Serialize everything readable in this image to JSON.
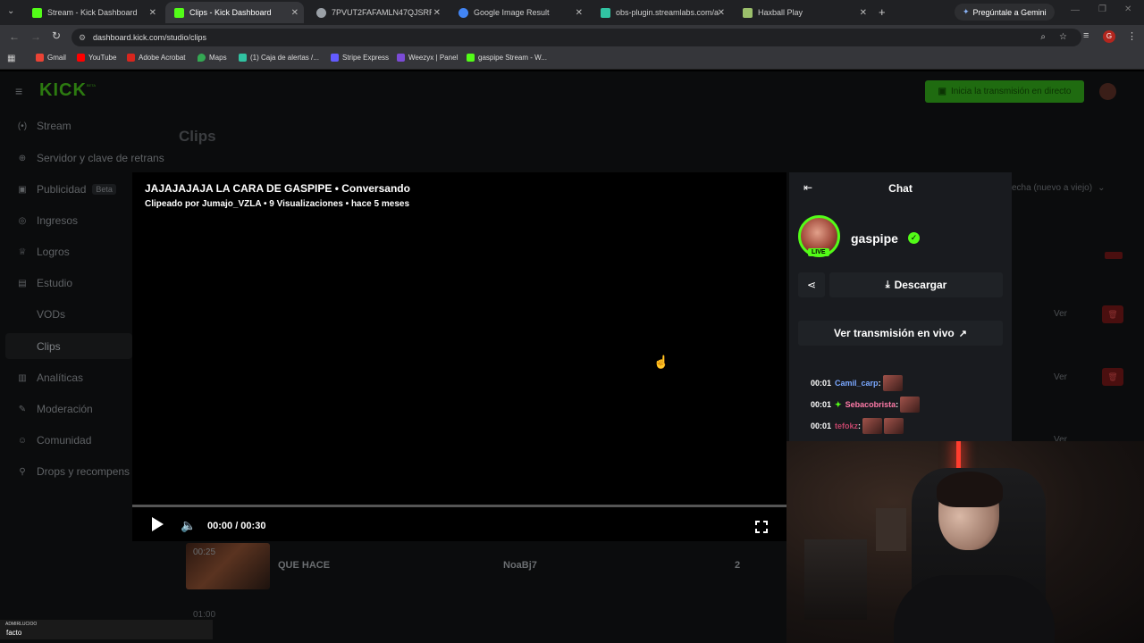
{
  "browser": {
    "tabs": [
      {
        "label": "Stream - Kick Dashboard",
        "favicon_color": "#53fc18"
      },
      {
        "label": "Clips - Kick Dashboard",
        "favicon_color": "#53fc18"
      },
      {
        "label": "7PVUT2FAFAMLN47QJSRR3AU",
        "favicon_color": "#9aa0a6"
      },
      {
        "label": "Google Image Result",
        "favicon_color": "#4285f4"
      },
      {
        "label": "obs-plugin.streamlabs.com/au",
        "favicon_color": "#31c3a2"
      },
      {
        "label": "Haxball Play",
        "favicon_color": "#9bbf6b"
      }
    ],
    "gemini_label": "Pregúntale a Gemini",
    "url": "dashboard.kick.com/studio/clips",
    "profile_initial": "G",
    "bookmarks": [
      {
        "label": "Gmail",
        "color": "#ea4335"
      },
      {
        "label": "YouTube",
        "color": "#ff0000"
      },
      {
        "label": "Adobe Acrobat",
        "color": "#d7261e"
      },
      {
        "label": "Maps",
        "color": "#34a853"
      },
      {
        "label": "(1) Caja de alertas /...",
        "color": "#31c3a2"
      },
      {
        "label": "Stripe Express",
        "color": "#635bff"
      },
      {
        "label": "Weezyx | Panel",
        "color": "#7b4bd6"
      },
      {
        "label": "gaspipe Stream - W...",
        "color": "#53fc18"
      }
    ]
  },
  "dashboard": {
    "logo_text": "KICK",
    "logo_badge": "BETA",
    "start_stream_label": "Inicia la transmisión en directo",
    "page_title": "Clips",
    "sort_label": "echa (nuevo a viejo)",
    "sidebar": [
      {
        "label": "Stream",
        "icon": "(•)"
      },
      {
        "label": "Servidor y clave de retrans",
        "icon": "⊕"
      },
      {
        "label": "Publicidad",
        "icon": "▣",
        "badge": "Beta"
      },
      {
        "label": "Ingresos",
        "icon": "◎"
      },
      {
        "label": "Logros",
        "icon": "♕"
      },
      {
        "label": "Estudio",
        "icon": "▤"
      },
      {
        "label": "VODs",
        "sub": true
      },
      {
        "label": "Clips",
        "sub": true,
        "active": true
      },
      {
        "label": "Analíticas",
        "icon": "▥"
      },
      {
        "label": "Moderación",
        "icon": "✎"
      },
      {
        "label": "Comunidad",
        "icon": "☺"
      },
      {
        "label": "Drops y recompens",
        "icon": "⚲"
      }
    ],
    "row_action": "Ver",
    "bg_clip": {
      "duration": "00:25",
      "title": "QUE HACE",
      "author": "NoaBj7",
      "views": "2"
    },
    "bg_clip_next_duration": "01:00"
  },
  "player": {
    "title": "JAJAJAJAJA LA CARA DE GASPIPE • Conversando",
    "meta": "Clipeado por Jumajo_VZLA • 9 Visualizaciones • hace 5 meses",
    "time": "00:00 / 00:30",
    "progress": 0
  },
  "chat": {
    "header": "Chat",
    "channel_name": "gaspipe",
    "live_badge": "LIVE",
    "download_label": "Descargar",
    "watch_live_label": "Ver transmisión en vivo",
    "messages": [
      {
        "time": "00:01",
        "user": "Camil_carp",
        "user_color": "#7aa8ff",
        "badge": false,
        "emotes": 1
      },
      {
        "time": "00:01",
        "user": "Sebacobrista",
        "user_color": "#ff7aa8",
        "badge": true,
        "emotes": 1
      },
      {
        "time": "00:01",
        "user": "tefokz",
        "user_color": "#c2456a",
        "badge": false,
        "emotes": 2
      }
    ]
  },
  "overlay": {
    "top_small": "ADMIRLUCIOO",
    "bottom_small": "facto"
  }
}
